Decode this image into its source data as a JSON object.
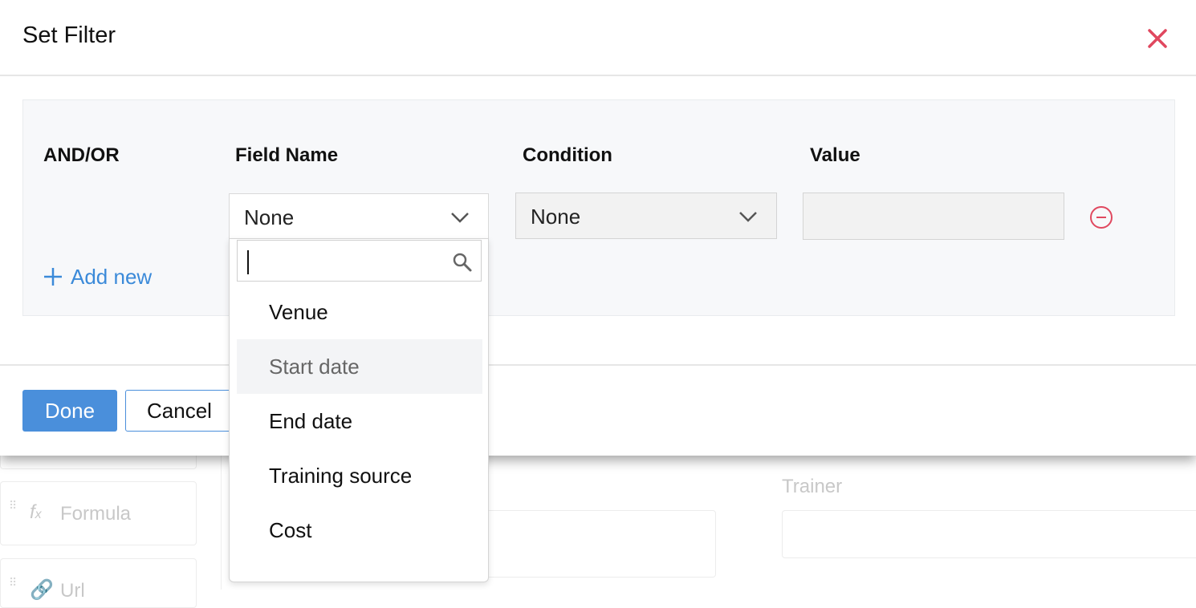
{
  "modal": {
    "title": "Set Filter",
    "columns": {
      "and_or": "AND/OR",
      "field_name": "Field Name",
      "condition": "Condition",
      "value": "Value"
    },
    "field_select_value": "None",
    "condition_select_value": "None",
    "value_input": "",
    "add_new_label": "Add new",
    "done_label": "Done",
    "cancel_label": "Cancel"
  },
  "dropdown": {
    "search_value": "",
    "items": [
      "Venue",
      "Start date",
      "End date",
      "Training source",
      "Cost"
    ],
    "hovered_item": "Start date"
  },
  "background": {
    "formula_label": "Formula",
    "url_label": "Url",
    "trainer_label": "Trainer"
  },
  "colors": {
    "accent": "#4a8fdb",
    "link": "#3b8ad9",
    "danger": "#e0485f"
  }
}
